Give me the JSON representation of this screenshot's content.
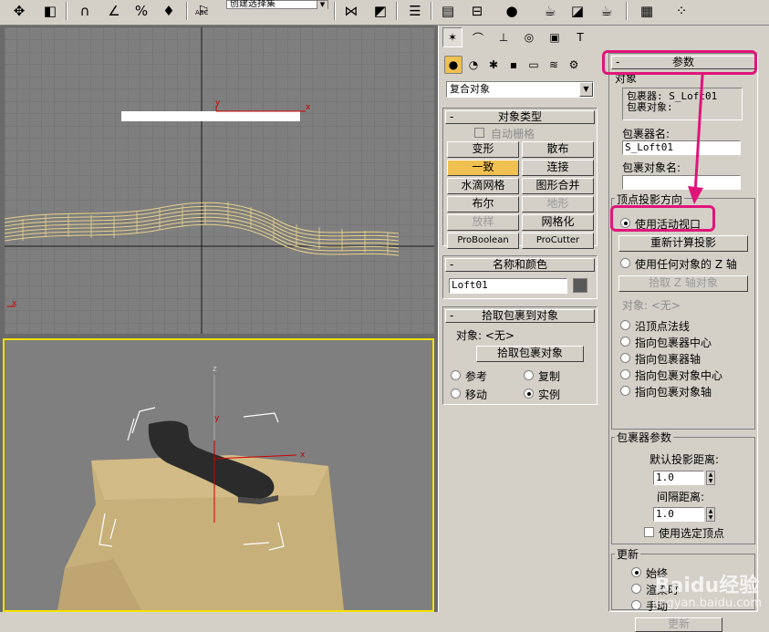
{
  "toolbar": {
    "selection_set_placeholder": "创建选择集",
    "abc_label": "ABC"
  },
  "viewports": {
    "top": {
      "axis_x": "x",
      "axis_y": "y"
    },
    "perspective": {
      "axis_x": "x",
      "axis_y": "y",
      "axis_z": "z"
    }
  },
  "command_panel": {
    "category_dropdown": "复合对象",
    "object_type": {
      "title": "对象类型",
      "auto_grid": "自动栅格",
      "buttons": [
        {
          "label": "变形",
          "state": "normal"
        },
        {
          "label": "散布",
          "state": "normal"
        },
        {
          "label": "一致",
          "state": "active"
        },
        {
          "label": "连接",
          "state": "normal"
        },
        {
          "label": "水滴网格",
          "state": "normal"
        },
        {
          "label": "图形合并",
          "state": "normal"
        },
        {
          "label": "布尔",
          "state": "normal"
        },
        {
          "label": "地形",
          "state": "disabled"
        },
        {
          "label": "放样",
          "state": "disabled"
        },
        {
          "label": "网格化",
          "state": "normal"
        },
        {
          "label": "ProBoolean",
          "state": "normal"
        },
        {
          "label": "ProCutter",
          "state": "normal"
        }
      ]
    },
    "name_color": {
      "title": "名称和颜色",
      "name_value": "Loft01",
      "color": "#595959"
    },
    "pick_wrapper": {
      "title": "拾取包裹到对象",
      "object_label": "对象: <无>",
      "pick_button": "拾取包裹对象",
      "radios": [
        {
          "label": "参考",
          "checked": false
        },
        {
          "label": "复制",
          "checked": false
        },
        {
          "label": "移动",
          "checked": false
        },
        {
          "label": "实例",
          "checked": true
        }
      ]
    }
  },
  "parameters": {
    "title": "参数",
    "objects_group": "对象",
    "wrapper_line": "包裹器: S_Loft01",
    "wrap_object_line": "包裹对象:",
    "wrapper_name_label": "包裹器名:",
    "wrapper_name_value": "S_Loft01",
    "wrap_object_name_label": "包裹对象名:",
    "wrap_object_name_value": "",
    "vertex_projection": {
      "title": "顶点投影方向",
      "use_active_viewport": "使用活动视口",
      "recalc_button": "重新计算投影",
      "use_any_object_z": "使用任何对象的 Z 轴",
      "pick_z_button": "拾取 Z 轴对象",
      "object_none": "对象: <无>",
      "along_vertex_normals": "沿顶点法线",
      "toward_wrapper_center": "指向包裹器中心",
      "toward_wrapper_pivot": "指向包裹器轴",
      "toward_wrap_object_center": "指向包裹对象中心",
      "toward_wrap_object_pivot": "指向包裹对象轴"
    },
    "wrapper_params": {
      "title": "包裹器参数",
      "default_projection_distance_label": "默认投影距离:",
      "default_projection_distance_value": "1.0",
      "standoff_distance_label": "间隔距离:",
      "standoff_distance_value": "1.0",
      "use_selected_vertices": "使用选定顶点"
    },
    "update": {
      "title": "更新",
      "always": "始终",
      "when_rendering": "渲染时",
      "manually": "手动",
      "update_button": "更新"
    }
  },
  "watermark": {
    "brand": "Baidu经验",
    "url": "jingyan.baidu.com"
  },
  "annotation_color": "#e0157a",
  "accent_active": "#f0c050"
}
